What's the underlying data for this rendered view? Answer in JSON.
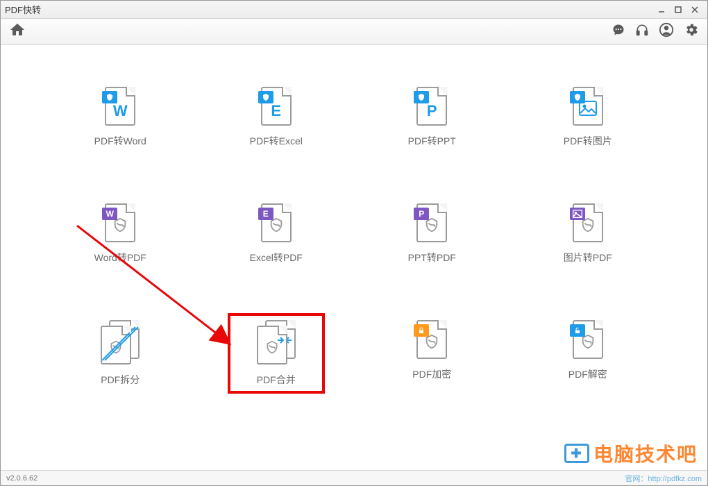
{
  "window": {
    "title": "PDF快转"
  },
  "footer": {
    "version": "v2.0.6.62",
    "link": "官网：http://pdfkz.com"
  },
  "tiles": [
    {
      "label": "PDF转Word",
      "tag": "W",
      "type": "pdf-to",
      "color": "blue"
    },
    {
      "label": "PDF转Excel",
      "tag": "E",
      "type": "pdf-to",
      "color": "blue"
    },
    {
      "label": "PDF转PPT",
      "tag": "P",
      "type": "pdf-to",
      "color": "blue"
    },
    {
      "label": "PDF转图片",
      "tag": "IMG",
      "type": "pdf-to",
      "color": "blue"
    },
    {
      "label": "Word转PDF",
      "tag": "W",
      "type": "to-pdf",
      "color": "purple"
    },
    {
      "label": "Excel转PDF",
      "tag": "E",
      "type": "to-pdf",
      "color": "purple"
    },
    {
      "label": "PPT转PDF",
      "tag": "P",
      "type": "to-pdf",
      "color": "purple"
    },
    {
      "label": "图片转PDF",
      "tag": "IMG",
      "type": "to-pdf",
      "color": "purple"
    },
    {
      "label": "PDF拆分",
      "type": "split"
    },
    {
      "label": "PDF合并",
      "type": "merge",
      "highlight": true
    },
    {
      "label": "PDF加密",
      "type": "encrypt"
    },
    {
      "label": "PDF解密",
      "type": "decrypt"
    }
  ],
  "watermark": {
    "text": "电脑技术吧"
  }
}
